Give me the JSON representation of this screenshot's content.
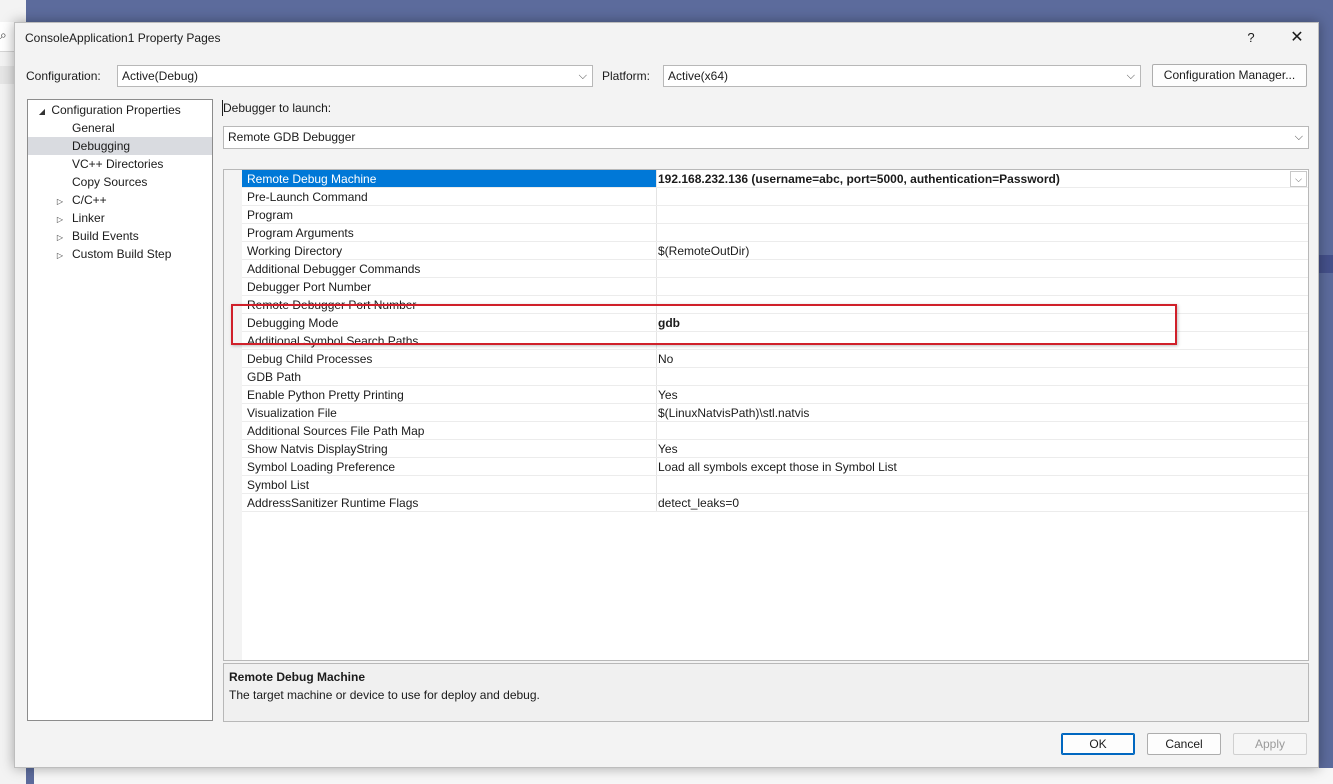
{
  "window": {
    "title": "ConsoleApplication1 Property Pages",
    "help_label": "?",
    "close_label": "✕"
  },
  "background": {
    "search_glyph": "⌕"
  },
  "config_bar": {
    "configuration_label": "Configuration:",
    "configuration_value": "Active(Debug)",
    "platform_label": "Platform:",
    "platform_value": "Active(x64)",
    "manager_button": "Configuration Manager..."
  },
  "tree": {
    "root": "Configuration Properties",
    "items": [
      {
        "label": "General",
        "expandable": false
      },
      {
        "label": "Debugging",
        "expandable": false,
        "selected": true
      },
      {
        "label": "VC++ Directories",
        "expandable": false
      },
      {
        "label": "Copy Sources",
        "expandable": false
      },
      {
        "label": "C/C++",
        "expandable": true
      },
      {
        "label": "Linker",
        "expandable": true
      },
      {
        "label": "Build Events",
        "expandable": true
      },
      {
        "label": "Custom Build Step",
        "expandable": true
      }
    ]
  },
  "debugger": {
    "launch_label": "Debugger to launch:",
    "launch_value": "Remote GDB Debugger"
  },
  "properties": [
    {
      "name": "Remote Debug Machine",
      "value": "192.168.232.136 (username=abc, port=5000, authentication=Password)",
      "bold": true,
      "selected": true
    },
    {
      "name": "Pre-Launch Command",
      "value": ""
    },
    {
      "name": "Program",
      "value": ""
    },
    {
      "name": "Program Arguments",
      "value": ""
    },
    {
      "name": "Working Directory",
      "value": "$(RemoteOutDir)"
    },
    {
      "name": "Additional Debugger Commands",
      "value": ""
    },
    {
      "name": "Debugger Port Number",
      "value": ""
    },
    {
      "name": "Remote Debugger Port Number",
      "value": ""
    },
    {
      "name": "Debugging Mode",
      "value": "gdb",
      "bold": true
    },
    {
      "name": "Additional Symbol Search Paths",
      "value": ""
    },
    {
      "name": "Debug Child Processes",
      "value": "No"
    },
    {
      "name": "GDB Path",
      "value": ""
    },
    {
      "name": "Enable Python Pretty Printing",
      "value": "Yes"
    },
    {
      "name": "Visualization File",
      "value": "$(LinuxNatvisPath)\\stl.natvis"
    },
    {
      "name": "Additional Sources File Path Map",
      "value": ""
    },
    {
      "name": "Show Natvis DisplayString",
      "value": "Yes"
    },
    {
      "name": "Symbol Loading Preference",
      "value": "Load all symbols except those in Symbol List"
    },
    {
      "name": "Symbol List",
      "value": ""
    },
    {
      "name": "AddressSanitizer Runtime Flags",
      "value": "detect_leaks=0"
    }
  ],
  "description": {
    "title": "Remote Debug Machine",
    "text": "The target machine or device to use for deploy and debug."
  },
  "buttons": {
    "ok": "OK",
    "cancel": "Cancel",
    "apply": "Apply"
  },
  "colors": {
    "selection": "#0078d7",
    "highlight_box": "#d0202a",
    "tree_selected": "#d9dbe0"
  },
  "icons": {
    "expanded": "◢",
    "collapsed": "▷",
    "dropdown": "⌵"
  }
}
